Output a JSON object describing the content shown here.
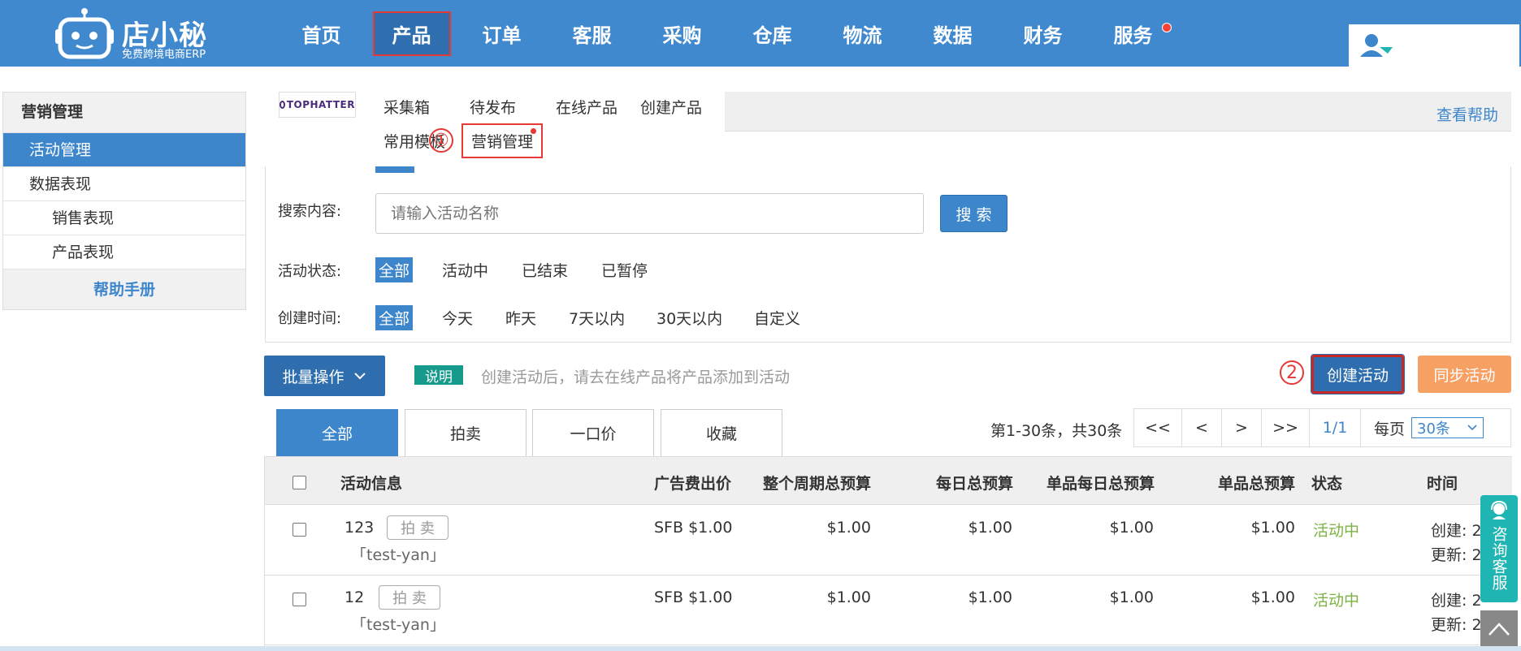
{
  "brand": {
    "name": "店小秘",
    "sub": "免费跨境电商ERP"
  },
  "nav": {
    "items": [
      {
        "label": "首页"
      },
      {
        "label": "产品"
      },
      {
        "label": "订单"
      },
      {
        "label": "客服"
      },
      {
        "label": "采购"
      },
      {
        "label": "仓库"
      },
      {
        "label": "物流"
      },
      {
        "label": "数据"
      },
      {
        "label": "财务"
      },
      {
        "label": "服务"
      }
    ],
    "active_index": 1
  },
  "sidebar": {
    "title": "营销管理",
    "items": [
      {
        "label": "活动管理"
      },
      {
        "label": "数据表现"
      },
      {
        "label": "销售表现"
      },
      {
        "label": "产品表现"
      }
    ],
    "help": "帮助手册"
  },
  "platform": {
    "logo_text": "TOPHATTER"
  },
  "subtabs": [
    {
      "label": "采集箱"
    },
    {
      "label": "待发布"
    },
    {
      "label": "在线产品"
    },
    {
      "label": "创建产品"
    },
    {
      "label": "常用模板"
    },
    {
      "label": "营销管理"
    }
  ],
  "help_link": "查看帮助",
  "steps": {
    "one": "①",
    "two": "2"
  },
  "filters": {
    "search_label": "搜索内容:",
    "search_placeholder": "请输入活动名称",
    "search_button": "搜 索",
    "status_label": "活动状态:",
    "status_options": [
      {
        "label": "全部"
      },
      {
        "label": "活动中"
      },
      {
        "label": "已结束"
      },
      {
        "label": "已暂停"
      }
    ],
    "time_label": "创建时间:",
    "time_options": [
      {
        "label": "全部"
      },
      {
        "label": "今天"
      },
      {
        "label": "昨天"
      },
      {
        "label": "7天以内"
      },
      {
        "label": "30天以内"
      },
      {
        "label": "自定义"
      }
    ]
  },
  "toolbar": {
    "bulk_label": "批量操作",
    "note_badge": "说明",
    "note_text": "创建活动后，请去在线产品将产品添加到活动",
    "create_label": "创建活动",
    "sync_label": "同步活动"
  },
  "type_tabs": [
    {
      "label": "全部"
    },
    {
      "label": "拍卖"
    },
    {
      "label": "一口价"
    },
    {
      "label": "收藏"
    }
  ],
  "pager": {
    "info": "第1-30条，共30条",
    "first": "<<",
    "prev": "<",
    "next": ">",
    "last": ">>",
    "current": "1/1",
    "per_page_label": "每页",
    "per_page_value": "30条"
  },
  "table": {
    "headers": {
      "info": "活动信息",
      "ad_price": "广告费出价",
      "period_budget": "整个周期总预算",
      "daily_budget": "每日总预算",
      "item_daily_budget": "单品每日总预算",
      "item_budget": "单品总预算",
      "status": "状态",
      "time": "时间"
    },
    "rows": [
      {
        "name": "123",
        "type": "拍 卖",
        "store": "「test-yan」",
        "ad_price": "SFB $1.00",
        "period_budget": "$1.00",
        "daily_budget": "$1.00",
        "item_daily_budget": "$1.00",
        "item_budget": "$1.00",
        "status": "活动中",
        "created": "创建: 2",
        "updated": "更新: 2"
      },
      {
        "name": "12",
        "type": "拍 卖",
        "store": "「test-yan」",
        "ad_price": "SFB $1.00",
        "period_budget": "$1.00",
        "daily_budget": "$1.00",
        "item_daily_budget": "$1.00",
        "item_budget": "$1.00",
        "status": "活动中",
        "created": "创建: 2",
        "updated": "更新: 2"
      }
    ]
  },
  "float": {
    "service": "咨询客服"
  },
  "colors": {
    "primary": "#4089cf",
    "accent": "#3e86cc",
    "highlight": "#e53935",
    "success": "#7cb342",
    "warning": "#f7a064",
    "teal": "#1fb5b2"
  }
}
